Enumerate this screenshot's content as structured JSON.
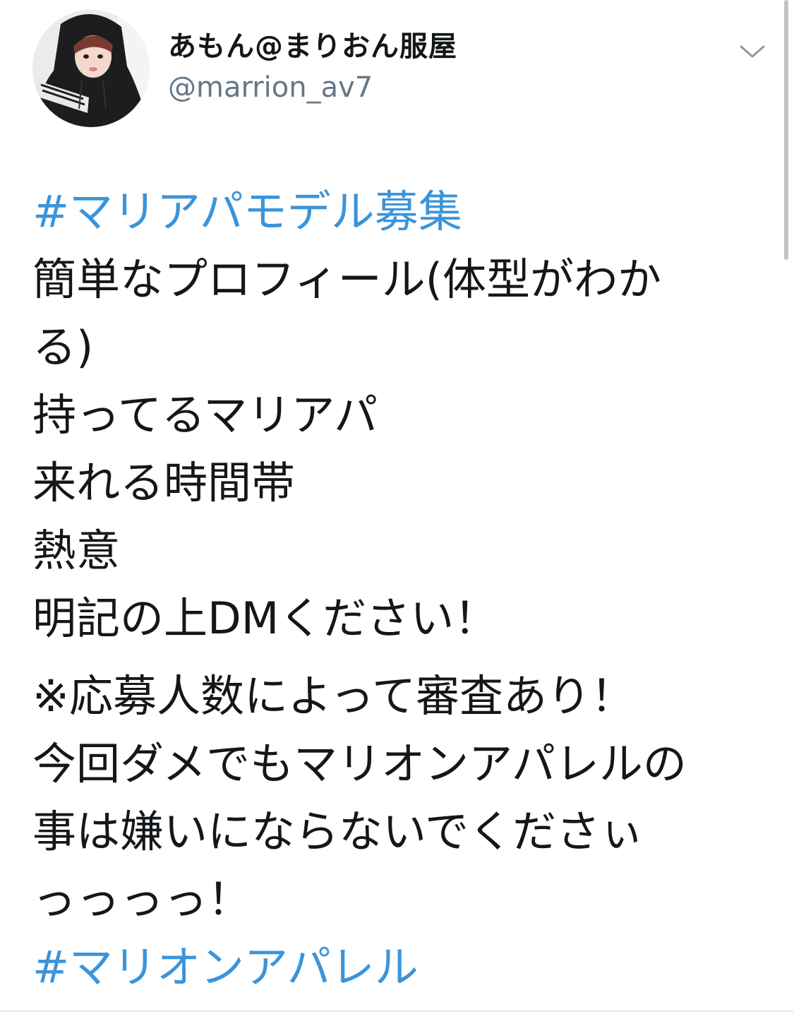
{
  "user": {
    "display_name": "あもん@まりおん服屋",
    "handle": "@marrion_av7",
    "avatar_icon": "profile-photo"
  },
  "menu": {
    "icon": "chevron-down-icon"
  },
  "tweet": {
    "hashtag1": "#マリアパモデル募集",
    "lines_block1": [
      "簡単なプロフィール(体型がわか",
      "る)",
      "持ってるマリアパ",
      "来れる時間帯",
      "熱意",
      "明記の上DMください！"
    ],
    "lines_block2": [
      "※応募人数によって審査あり！",
      "今回ダメでもマリオンアパレルの",
      "事は嫌いにならないでくださぃ",
      "っっっっ！"
    ],
    "hashtag2": "#マリオンアパレル"
  },
  "colors": {
    "link": "#3b94d9",
    "text": "#14171a",
    "muted": "#657786"
  }
}
